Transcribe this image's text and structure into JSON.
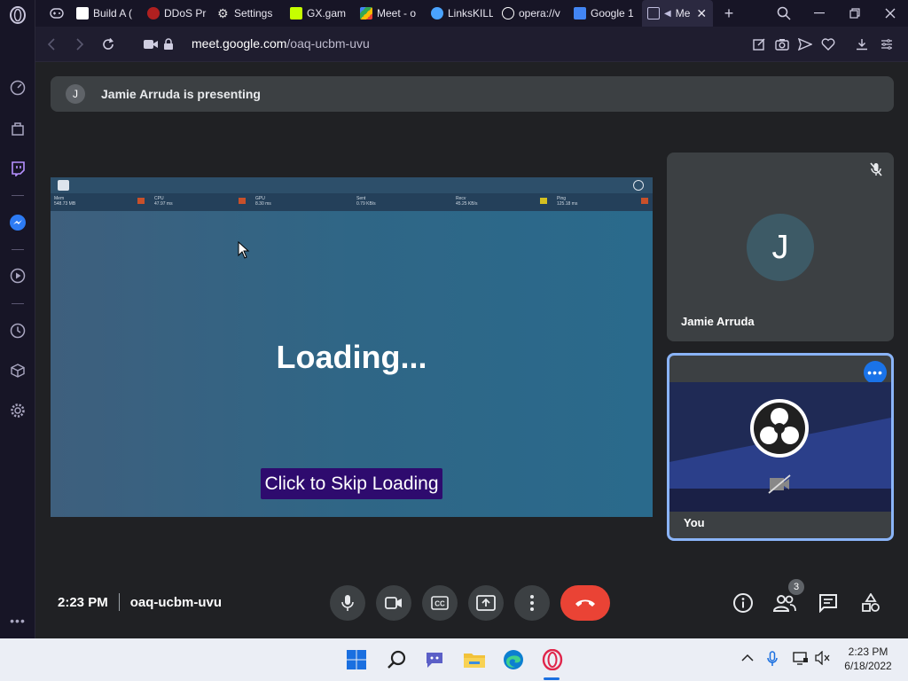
{
  "tabs": [
    {
      "label": "Build A (",
      "color": "#ffffff"
    },
    {
      "label": "DDoS Pr",
      "color": "#b02020"
    },
    {
      "label": "Settings",
      "color": "#e0e0e0"
    },
    {
      "label": "GX.gam",
      "color": "#c6ff00"
    },
    {
      "label": "Meet - o",
      "color": "#34a853"
    },
    {
      "label": "LinksKILL",
      "color": "#4aa3ff"
    },
    {
      "label": "opera://v",
      "color": "#ffffff"
    },
    {
      "label": "Google 1",
      "color": "#4285f4"
    },
    {
      "label": "Me",
      "color": "#c0bede"
    }
  ],
  "url": {
    "domain": "meet.google.com",
    "path": "/oaq-ucbm-uvu"
  },
  "banner": {
    "initial": "J",
    "text": "Jamie Arruda is presenting"
  },
  "presentation": {
    "loading": "Loading...",
    "skip": "Click to Skip Loading",
    "stats": [
      {
        "label": "Mem",
        "value": "548.73 MB"
      },
      {
        "label": "CPU",
        "value": "47.97 ms"
      },
      {
        "label": "GPU",
        "value": "8.30 ms"
      },
      {
        "label": "Sent",
        "value": "0.79 KB/s"
      },
      {
        "label": "Recv",
        "value": "45.25 KB/s"
      },
      {
        "label": "Ping",
        "value": "125.18 ms"
      }
    ]
  },
  "participants": [
    {
      "initial": "J",
      "name": "Jamie Arruda"
    },
    {
      "name": "You"
    }
  ],
  "meeting": {
    "time": "2:23 PM",
    "code": "oaq-ucbm-uvu",
    "people_count": "3"
  },
  "clock": {
    "time": "2:23 PM",
    "date": "6/18/2022"
  },
  "colors": {
    "accent": "#8ab4f8",
    "end_call": "#ea4335",
    "more_button": "#1a73e8",
    "skip_bg": "#2e0b6e"
  }
}
